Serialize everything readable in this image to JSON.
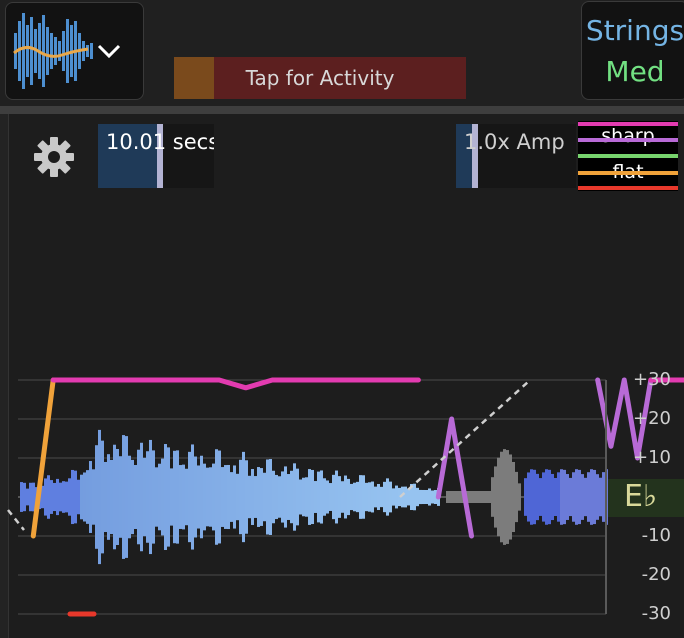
{
  "header": {
    "activity_label": "Tap for Activity",
    "instrument": {
      "name": "Strings",
      "mode": "Med"
    },
    "waveform_button_icon": "waveform-icon",
    "dropdown_icon": "chevron-down-icon"
  },
  "controls": {
    "settings_icon": "gear-icon",
    "duration_label": "10.01 secs",
    "amp_label": "1.0x Amp"
  },
  "legend": {
    "sharp_label": "sharp",
    "flat_label": "flat",
    "colors": {
      "top": "#e23bb0",
      "sharp": "#b86ad6",
      "mid": "#77d36d",
      "flat": "#f0a23a",
      "bottom": "#e8382b"
    }
  },
  "pitch_scale": {
    "labels": [
      "+30",
      "+20",
      "+10",
      "-10",
      "-20",
      "-30"
    ],
    "note": "E♭"
  },
  "chart_data": {
    "type": "line",
    "ylim": [
      -30,
      30
    ],
    "yticks": [
      30,
      20,
      10,
      0,
      -10,
      -20,
      -30
    ],
    "series": [
      {
        "color": "#f0a23a",
        "points": [
          [
            0.02,
            -10
          ],
          [
            0.05,
            30
          ]
        ]
      },
      {
        "color": "#e23bb0",
        "points": [
          [
            0.05,
            30
          ],
          [
            0.3,
            30
          ],
          [
            0.34,
            28
          ],
          [
            0.38,
            30
          ],
          [
            0.6,
            30
          ]
        ]
      },
      {
        "color": "#b86ad6",
        "points": [
          [
            0.63,
            0
          ],
          [
            0.65,
            20
          ],
          [
            0.68,
            -10
          ]
        ]
      },
      {
        "color": "#b86ad6",
        "points": [
          [
            0.87,
            30
          ],
          [
            0.89,
            13
          ],
          [
            0.91,
            30
          ],
          [
            0.93,
            10
          ],
          [
            0.95,
            30
          ]
        ]
      },
      {
        "color": "#e23bb0",
        "points": [
          [
            0.95,
            30
          ],
          [
            1.0,
            30
          ]
        ]
      }
    ]
  }
}
